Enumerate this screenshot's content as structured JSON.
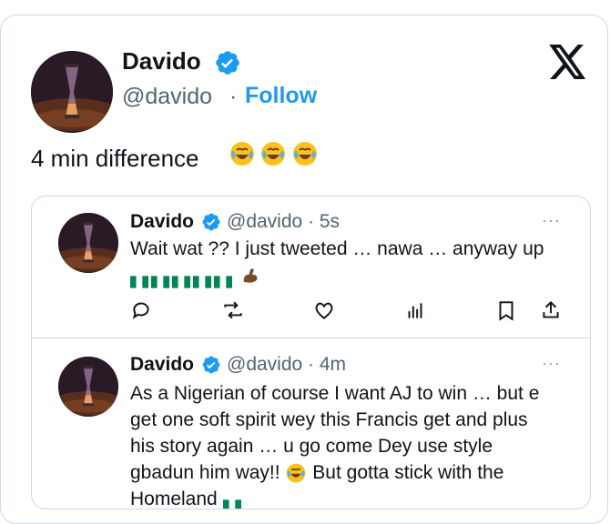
{
  "author": {
    "name": "Davido",
    "handle": "@davido",
    "separator": "·",
    "follow_label": "Follow"
  },
  "tweet": {
    "text": "4 min difference",
    "emojis": [
      "joy",
      "joy",
      "joy"
    ]
  },
  "quoted": [
    {
      "name": "Davido",
      "handle_time": "@davido · 5s",
      "text": "Wait wat ?? I just tweeted … nawa … anyway up",
      "more": "···"
    },
    {
      "name": "Davido",
      "handle_time": "@davido · 4m",
      "text_line1": "As a Nigerian of course I want AJ to win … but e",
      "text_line2": "get one soft spirit wey this Francis get and plus",
      "text_line3": "his story again … u go come Dey use style",
      "text_line4": "gbadun him way!!",
      "text_line4b": "But gotta stick with the",
      "text_line5": "Homeland",
      "more": "···"
    }
  ],
  "icons": {
    "verified": "verified-badge-icon",
    "x": "x-logo-icon",
    "reply": "reply-icon",
    "retweet": "retweet-icon",
    "like": "like-icon",
    "views": "views-icon",
    "bookmark": "bookmark-icon",
    "share": "share-icon"
  },
  "colors": {
    "accent": "#1d9bf0",
    "secondary_text": "#536471",
    "border": "#cfd9de"
  }
}
